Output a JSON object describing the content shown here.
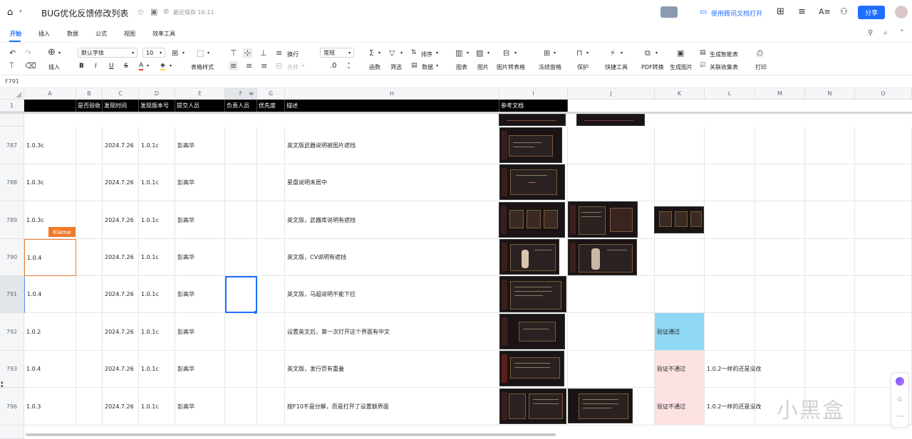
{
  "doc": {
    "title": "BUG优化反馈修改列表",
    "save_status": "最近保存 16:11",
    "open_in_app": "使用腾讯文档打开",
    "share_label": "分享"
  },
  "menu": [
    "开始",
    "插入",
    "数据",
    "公式",
    "视图",
    "效率工具"
  ],
  "toolbar": {
    "insert": "插入",
    "font": "默认字体",
    "font_size": "10",
    "table_style": "表格样式",
    "wrap": "换行",
    "merge": "合并",
    "number_format": "常规",
    "decimal": ".0",
    "sort": "排序",
    "function": "函数",
    "filter": "筛选",
    "data": "数据",
    "chart": "图表",
    "image": "图片",
    "image_to_table": "图片转表格",
    "freeze": "冻结窗格",
    "protect": "保护",
    "quick_tools": "快捷工具",
    "pdf": "PDF转换",
    "gen_image": "生成图片",
    "smart_table": "生成智能表",
    "linked_form": "关联收集表",
    "print": "打印"
  },
  "name_box": "F791",
  "columns": [
    "A",
    "B",
    "C",
    "D",
    "E",
    "F",
    "G",
    "H",
    "I",
    "J",
    "K",
    "L",
    "M",
    "N",
    "O"
  ],
  "header_row": {
    "num": "1",
    "cells": [
      "",
      "是否验收",
      "发现时间",
      "发现版本号",
      "提交人员",
      "负责人员",
      "优先度",
      "描述",
      "参考文档"
    ]
  },
  "rows": [
    {
      "num": "787",
      "a": "1.0.3c",
      "c": "2024.7.26",
      "d": "1.0.1c",
      "e": "彭高华",
      "h": "英文版武器说明被图片遮挡",
      "k": "",
      "l": ""
    },
    {
      "num": "788",
      "a": "1.0.3c",
      "c": "2024.7.26",
      "d": "1.0.1c",
      "e": "彭高华",
      "h": "星盘说明未居中",
      "k": "",
      "l": ""
    },
    {
      "num": "789",
      "a": "1.0.3c",
      "c": "2024.7.26",
      "d": "1.0.1c",
      "e": "彭高华",
      "h": "英文版，武器库说明有遮挡",
      "k": "",
      "l": ""
    },
    {
      "num": "790",
      "a": "1.0.4",
      "c": "2024.7.26",
      "d": "1.0.1c",
      "e": "彭高华",
      "h": "英文版，CV说明有遮挡",
      "k": "",
      "l": ""
    },
    {
      "num": "791",
      "a": "1.0.4",
      "c": "2024.7.26",
      "d": "1.0.1c",
      "e": "彭高华",
      "h": "英文版，马超说明不能下拉",
      "k": "",
      "l": ""
    },
    {
      "num": "792",
      "a": "1.0.2",
      "c": "2024.7.26",
      "d": "1.0.1c",
      "e": "彭高华",
      "h": "设置英文后，第一次打开这个界面有中文",
      "k": "验证通过",
      "l": ""
    },
    {
      "num": "793",
      "a": "1.0.4",
      "c": "2024.7.26",
      "d": "1.0.1c",
      "e": "彭高华",
      "h": "英文版，发行页有重叠",
      "k": "验证不通过",
      "l": "1.0.2一样的还是没改"
    },
    {
      "num": "796",
      "a": "1.0.3",
      "c": "2024.7.26",
      "d": "1.0.1c",
      "e": "彭高华",
      "h": "按F10不是分解，而是打开了设置额界面",
      "k": "验证不通过",
      "l": "1.0.2一样的还是没改"
    }
  ],
  "collab_tag": "Klame",
  "watermark": "小黑盒",
  "colors": {
    "accent": "#1e6fff",
    "pass": "#8fd8f5",
    "fail": "#fde2e2",
    "collab": "#f07a2b"
  }
}
